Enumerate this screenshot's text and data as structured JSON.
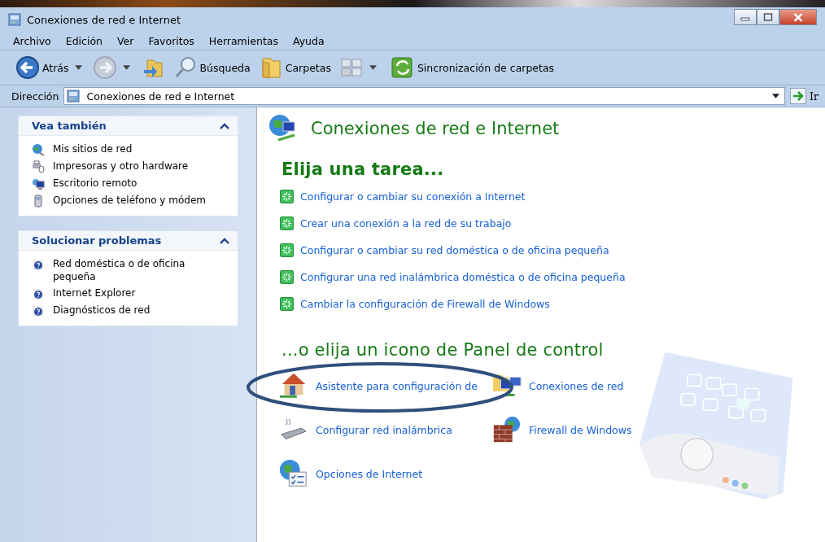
{
  "window": {
    "title": "Conexiones de red e Internet"
  },
  "menu": [
    "Archivo",
    "Edición",
    "Ver",
    "Favoritos",
    "Herramientas",
    "Ayuda"
  ],
  "toolbar": [
    {
      "kind": "back",
      "label": "Atrás",
      "disabled": false
    },
    {
      "kind": "forward",
      "disabled": true
    },
    {
      "kind": "up",
      "disabled": false
    },
    {
      "kind": "search",
      "label": "Búsqueda",
      "disabled": false
    },
    {
      "kind": "folders",
      "label": "Carpetas",
      "disabled": false
    },
    {
      "kind": "views",
      "disabled": false
    },
    {
      "kind": "sync",
      "label": "Sincronización de carpetas",
      "disabled": false
    }
  ],
  "address": {
    "label": "Dirección",
    "value": "Conexiones de red e Internet",
    "go": "Ir"
  },
  "sidebar": [
    {
      "title": "Vea también",
      "expanded": true,
      "items": [
        {
          "label": "Mis sitios de red",
          "kind": "network"
        },
        {
          "label": "Impresoras y otro hardware",
          "kind": "printer"
        },
        {
          "label": "Escritorio remoto",
          "kind": "remote"
        },
        {
          "label": "Opciones de teléfono y módem",
          "kind": "phone"
        }
      ]
    },
    {
      "title": "Solucionar problemas",
      "expanded": true,
      "items": [
        {
          "label": "Red doméstica o de oficina pequeña",
          "kind": "help"
        },
        {
          "label": "Internet Explorer",
          "kind": "help"
        },
        {
          "label": "Diagnósticos de red",
          "kind": "help"
        }
      ]
    }
  ],
  "content": {
    "title": "Conexiones de red e Internet",
    "tasks_heading": "Elija una tarea...",
    "tasks": [
      "Configurar o cambiar su conexión a Internet",
      "Crear una conexión a la red de su trabajo",
      "Configurar o cambiar su red doméstica o de oficina pequeña",
      "Configurar una red inalámbrica doméstica o de oficina pequeña",
      "Cambiar la configuración de Firewall de Windows"
    ],
    "icons_heading": "...o elija un icono de Panel de control",
    "icons": [
      {
        "label": "Asistente para configuración de",
        "kind": "house"
      },
      {
        "label": "Conexiones de red",
        "kind": "connections"
      },
      {
        "label": "Configurar red inalámbrica",
        "kind": "wireless"
      },
      {
        "label": "Firewall de Windows",
        "kind": "firewall"
      },
      {
        "label": "Opciones de Internet",
        "kind": "options"
      }
    ]
  }
}
